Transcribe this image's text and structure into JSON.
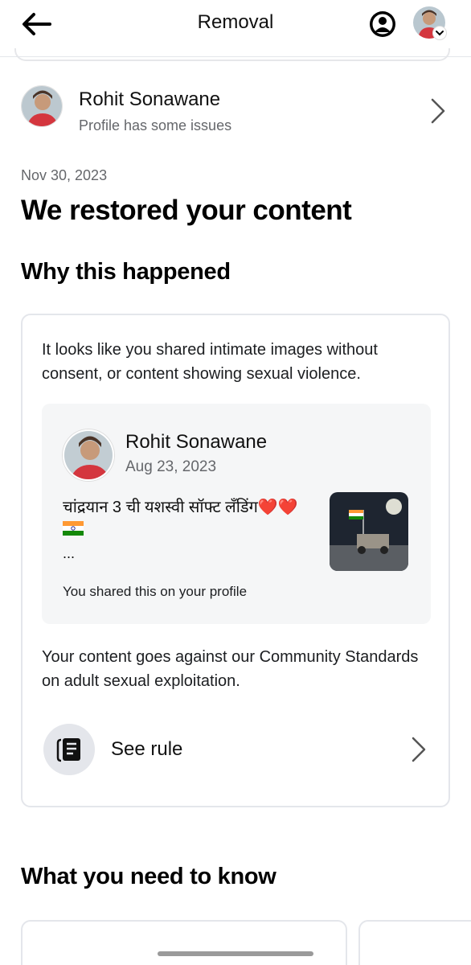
{
  "header": {
    "title": "Removal"
  },
  "profile": {
    "name": "Rohit Sonawane",
    "status": "Profile has some issues"
  },
  "content": {
    "date": "Nov 30, 2023",
    "title": "We restored your content",
    "why_title": "Why this happened",
    "reason": "It looks like you shared intimate images without consent, or content showing sexual violence.",
    "post": {
      "author": "Rohit Sonawane",
      "date": "Aug 23, 2023",
      "text": "चांद्रयान 3 ची यशस्वी सॉफ्ट लँडिंग❤️❤️",
      "ellipsis": "...",
      "shared_note": "You shared this on your profile"
    },
    "standards": "Your content goes against our Community Standards on adult sexual exploitation.",
    "see_rule_label": "See rule",
    "need_to_know_title": "What you need to know"
  },
  "icons": {
    "back": "back-arrow-icon",
    "account": "account-circle-icon",
    "chevron": "chevron-right-icon",
    "rule": "rulebook-icon",
    "flag": "india-flag-emoji"
  }
}
